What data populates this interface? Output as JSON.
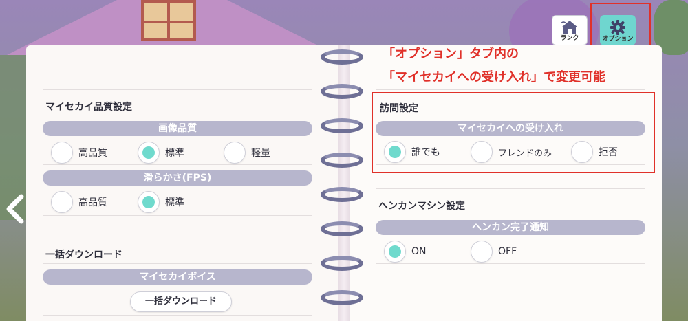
{
  "top_buttons": {
    "rank_label": "ランク",
    "option_label": "オプション"
  },
  "annotation": {
    "line1": "「オプション」タブ内の",
    "line2": "「マイセカイへの受け入れ」で変更可能"
  },
  "left_page": {
    "quality_section": {
      "title": "マイセカイ品質設定",
      "image_quality": {
        "label": "画像品質",
        "options": [
          "高品質",
          "標準",
          "軽量"
        ],
        "selected": "標準"
      },
      "fps": {
        "label": "滑らかさ(FPS)",
        "options": [
          "高品質",
          "標準"
        ],
        "selected": "標準"
      }
    },
    "download_section": {
      "title": "一括ダウンロード",
      "voice_label": "マイセカイボイス",
      "button_label": "一括ダウンロード"
    }
  },
  "right_page": {
    "visit_section": {
      "title": "訪問設定",
      "accept_label": "マイセカイへの受け入れ",
      "options": [
        "誰でも",
        "フレンドのみ",
        "拒否"
      ],
      "selected": "誰でも"
    },
    "henkan_section": {
      "title": "ヘンカンマシン設定",
      "notify_label": "ヘンカン完了通知",
      "options": [
        "ON",
        "OFF"
      ],
      "selected": "ON"
    }
  },
  "colors": {
    "accent": "#6fdacd",
    "bar": "#b7b6cd",
    "highlight": "#e0312a"
  }
}
